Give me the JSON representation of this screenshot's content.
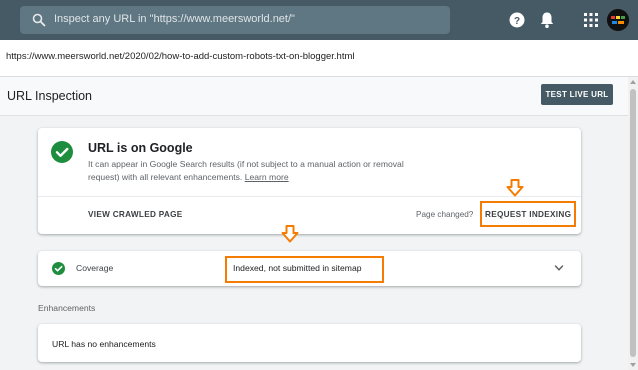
{
  "search": {
    "placeholder": "Inspect any URL in \"https://www.meersworld.net/\""
  },
  "url_bar": {
    "url": "https://www.meersworld.net/2020/02/how-to-add-custom-robots-txt-on-blogger.html"
  },
  "inspection": {
    "title": "URL Inspection",
    "test_live_label": "TEST LIVE URL"
  },
  "main_card": {
    "title": "URL is on Google",
    "description": "It can appear in Google Search results (if not subject to a manual action or removal request) with all relevant enhancements.",
    "learn_more": "Learn more",
    "view_crawled_label": "VIEW CRAWLED PAGE",
    "page_changed": "Page changed?",
    "request_indexing_label": "REQUEST INDEXING"
  },
  "coverage": {
    "label": "Coverage",
    "value": "Indexed, not submitted in sitemap"
  },
  "enhancements": {
    "heading": "Enhancements",
    "text": "URL has no enhancements"
  },
  "colors": {
    "topbar": "#455a64",
    "success_green": "#1e8e3e",
    "highlight_orange": "#f57c00"
  },
  "icons": [
    "search-icon",
    "help-icon",
    "bell-icon",
    "apps-icon",
    "check-circle-icon",
    "chevron-down-icon",
    "arrow-down-icon"
  ]
}
